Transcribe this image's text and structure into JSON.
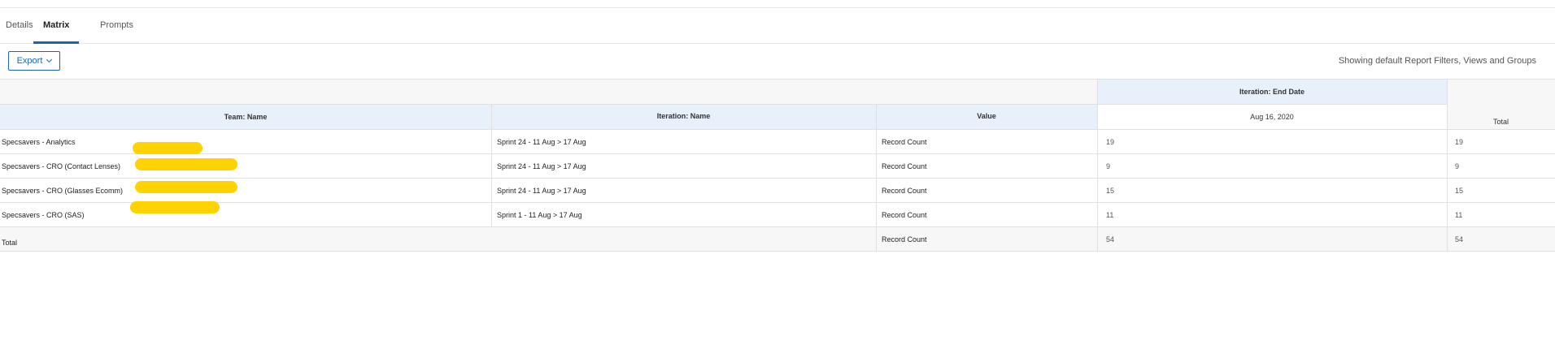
{
  "tabs": [
    {
      "label": "Details",
      "active": false
    },
    {
      "label": "Matrix",
      "active": true
    },
    {
      "label": "Prompts",
      "active": false
    }
  ],
  "toolbar": {
    "export_label": "Export",
    "filters_note": "Showing default Report Filters, Views and Groups"
  },
  "matrix": {
    "group_header": "Iteration: End Date",
    "columns": {
      "team": "Team: Name",
      "iteration": "Iteration: Name",
      "value": "Value",
      "date": "Aug 16, 2020",
      "total": "Total"
    },
    "rows": [
      {
        "team": "Specsavers - Analytics",
        "iteration": "Sprint 24 - 11 Aug > 17 Aug",
        "value": "Record Count",
        "date_value": "19",
        "total": "19"
      },
      {
        "team": "Specsavers - CRO (Contact Lenses)",
        "iteration": "Sprint 24 - 11 Aug > 17 Aug",
        "value": "Record Count",
        "date_value": "9",
        "total": "9"
      },
      {
        "team": "Specsavers - CRO (Glasses Ecomm)",
        "iteration": "Sprint 24 - 11 Aug > 17 Aug",
        "value": "Record Count",
        "date_value": "15",
        "total": "15"
      },
      {
        "team": "Specsavers - CRO (SAS)",
        "iteration": "Sprint 1 - 11 Aug > 17 Aug",
        "value": "Record Count",
        "date_value": "11",
        "total": "11"
      }
    ],
    "total_row": {
      "label": "Total",
      "value": "Record Count",
      "date_value": "54",
      "total": "54"
    }
  },
  "colors": {
    "accent": "#1a64b0",
    "header_bg": "#e8f1fb",
    "highlight": "#ffd200"
  }
}
